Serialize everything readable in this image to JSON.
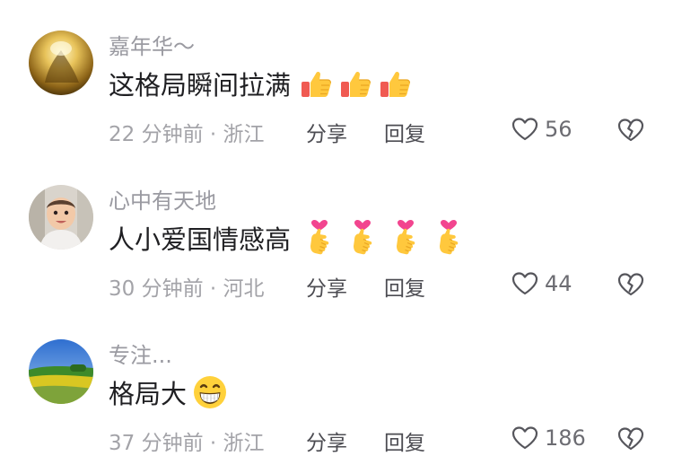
{
  "comments": [
    {
      "username": "嘉年华～",
      "text": "这格局瞬间拉满",
      "emojis": [
        "thumbs-up-emoji",
        "thumbs-up-emoji",
        "thumbs-up-emoji"
      ],
      "time_location": "22 分钟前 · 浙江",
      "share_label": "分享",
      "reply_label": "回复",
      "likes": "56",
      "avatar": "golden-abstract-avatar"
    },
    {
      "username": "心中有天地",
      "text": "人小爱国情感高",
      "emojis": [
        "finger-heart-emoji",
        "finger-heart-emoji",
        "finger-heart-emoji",
        "finger-heart-emoji"
      ],
      "time_location": "30 分钟前 · 河北",
      "share_label": "分享",
      "reply_label": "回复",
      "likes": "44",
      "avatar": "baby-photo-avatar"
    },
    {
      "username": "专注...",
      "text": "格局大",
      "emojis": [
        "grinning-face-emoji"
      ],
      "time_location": "37 分钟前 · 浙江",
      "share_label": "分享",
      "reply_label": "回复",
      "likes": "186",
      "avatar": "landscape-photo-avatar"
    }
  ],
  "icons": {
    "like": "heart-outline-icon",
    "dislike": "broken-heart-icon"
  },
  "colors": {
    "username": "#9a9aa1",
    "text": "#1f1f22",
    "meta": "#a3a3a8",
    "action": "#4c4c52"
  }
}
